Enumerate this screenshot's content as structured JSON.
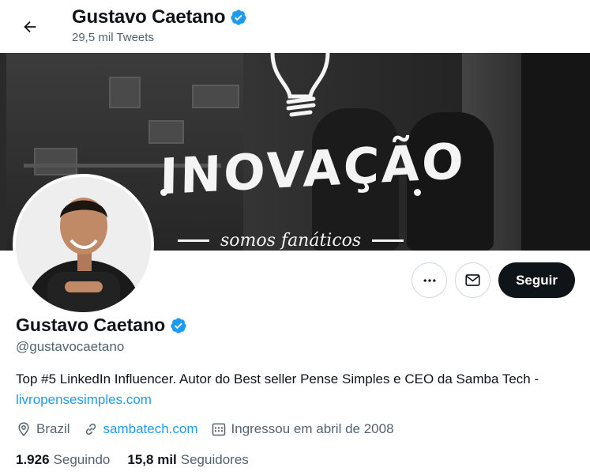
{
  "header": {
    "title": "Gustavo Caetano",
    "tweet_count": "29,5 mil Tweets"
  },
  "banner": {
    "headline": "INOVAÇÃO",
    "tagline": "somos fanáticos"
  },
  "profile": {
    "name": "Gustavo Caetano",
    "handle": "@gustavocaetano",
    "bio_text": "Top #5 LinkedIn Influencer. Autor do Best seller Pense Simples e CEO da Samba Tech  - ",
    "bio_link": "livropensesimples.com",
    "location": "Brazil",
    "website": "sambatech.com",
    "joined": "Ingressou em abril de 2008",
    "following_count": "1.926",
    "following_label": "Seguindo",
    "followers_count": "15,8 mil",
    "followers_label": "Seguidores"
  },
  "actions": {
    "more_icon": "more-icon",
    "message_icon": "mail-icon",
    "follow_label": "Seguir"
  },
  "colors": {
    "accent": "#1d9bf0",
    "primary_text": "#0f1419",
    "secondary_text": "#536471",
    "follow_bg": "#0f1419"
  }
}
